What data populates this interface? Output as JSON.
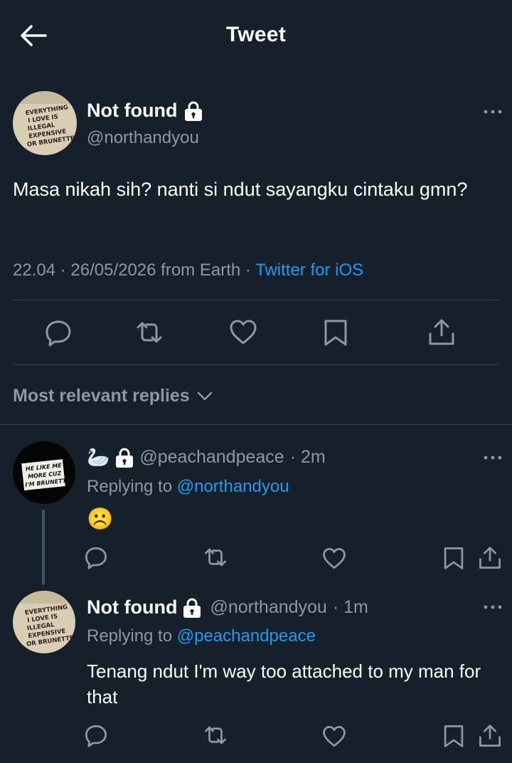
{
  "header": {
    "title": "Tweet",
    "back_icon": "arrow-left-icon"
  },
  "tweet": {
    "name": "Not found",
    "handle": "@northandyou",
    "avatar_text": [
      "EVERYTHING",
      "I LOVE IS",
      "ILLEGAL",
      "EXPENSIVE",
      "OR BRUNETTE"
    ],
    "text": "Masa nikah sih? nanti si ndut sayangku cintaku gmn?",
    "time": "22.04 · 26/05/2026 from Earth",
    "sep": " · ",
    "source": "Twitter for iOS",
    "actions": [
      "reply-icon",
      "retweet-icon",
      "like-icon",
      "bookmark-icon",
      "share-icon"
    ]
  },
  "sort": {
    "label": "Most relevant replies"
  },
  "replies": [
    {
      "handle": "@peachandpeace",
      "time": "· 2m",
      "name_emoji": "🦢",
      "replying_prefix": "Replying to ",
      "replying_to": "@northandyou",
      "text": "☹️",
      "avatar_text": [
        "HE LIKE ME",
        "MORE CUZ",
        "I'M BRUNETTE"
      ]
    },
    {
      "name": "Not found",
      "handle": "@northandyou",
      "time": "· 1m",
      "replying_prefix": "Replying to ",
      "replying_to": "@peachandpeace",
      "text": "Tenang ndut I'm way too attached to my man for that",
      "avatar_text": [
        "EVERYTHING",
        "I LOVE IS",
        "ILLEGAL",
        "EXPENSIVE",
        "OR BRUNETTE"
      ]
    }
  ],
  "colors": {
    "background": "#15202b",
    "accent": "#1d9bf0",
    "muted": "#8b98a5",
    "divider": "#38444d"
  }
}
